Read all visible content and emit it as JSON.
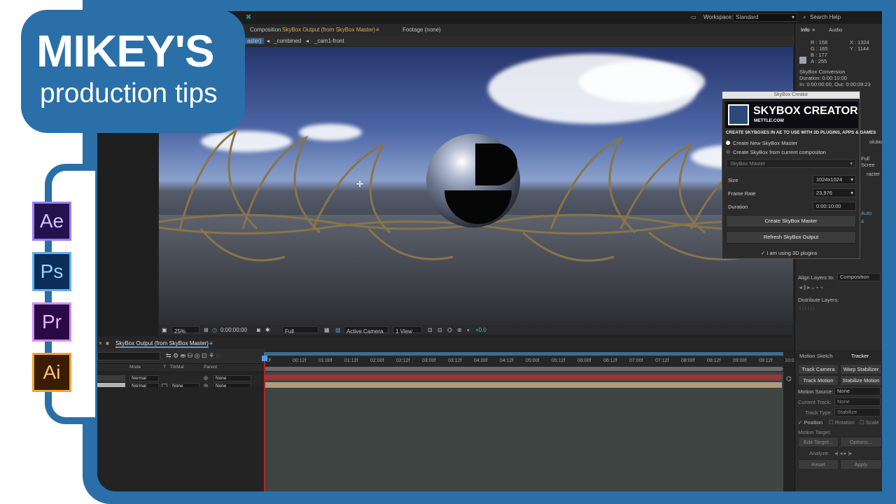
{
  "brand": {
    "title": "MIKEY'S",
    "subtitle": "production tips"
  },
  "apps": [
    "Ae",
    "Ps",
    "Pr",
    "Ai"
  ],
  "topbar": {
    "workspace_label": "Workspace:",
    "workspace_value": "Standard",
    "search_placeholder": "Search Help"
  },
  "composition": {
    "tab_label": "Composition",
    "tab_name": "SkyBox Output (from SkyBox Master)",
    "footage_tab": "Footage (none)",
    "subnav": [
      "aster)",
      "_combined",
      "_cam1-front"
    ]
  },
  "viewer_bar": {
    "zoom": "25%",
    "timecode": "0:00:00:00",
    "resolution": "Full",
    "camera": "Active Camera",
    "views": "1 View",
    "exposure": "+0.0"
  },
  "info_panel": {
    "tabs": [
      "Info",
      "Audio"
    ],
    "r": "R : 158",
    "g": "G : 165",
    "b": "B : 177",
    "a": "A : 255",
    "x": "X : 1324",
    "y": "Y : 1144",
    "comp_name": "SkyBox Conversion",
    "duration": "Duration: 0:00:10:00",
    "inout": "In: 0:00:00:00, Out: 0:00:09:23"
  },
  "right_misc": {
    "frag1": "olution",
    "frag2": "Full Scree",
    "frag3": "racter",
    "frag4": "Auto",
    "frag5": "4"
  },
  "align": {
    "label": "Align Layers to:",
    "value": "Composition",
    "distribute": "Distribute Layers:"
  },
  "tracker": {
    "tabs": [
      "Motion Sketch",
      "Tracker"
    ],
    "track_camera": "Track Camera",
    "warp_stabilizer": "Warp Stabilizer",
    "track_motion": "Track Motion",
    "stabilize_motion": "Stabilize Motion",
    "motion_source_label": "Motion Source:",
    "motion_source_value": "None",
    "current_track_label": "Current Track:",
    "current_track_value": "None",
    "track_type_label": "Track Type:",
    "track_type_value": "Stabilize",
    "position": "Position",
    "rotation": "Rotation",
    "scale": "Scale",
    "motion_target": "Motion Target:",
    "edit_target": "Edit Target...",
    "options": "Options...",
    "analyze": "Analyze:",
    "reset": "Reset",
    "apply": "Apply"
  },
  "timeline": {
    "tab": "SkyBox Output (from SkyBox Master)",
    "columns": [
      "Mode",
      "T",
      "TrkMat",
      "Parent"
    ],
    "layers": [
      {
        "mode": "Normal",
        "trkmat": "",
        "parent": "None"
      },
      {
        "mode": "Normal",
        "trkmat": "None",
        "parent": "None"
      }
    ],
    "ruler": [
      "0f",
      "00:12f",
      "01:00f",
      "01:12f",
      "02:00f",
      "02:12f",
      "03:00f",
      "03:12f",
      "04:00f",
      "04:12f",
      "05:00f",
      "05:12f",
      "06:00f",
      "06:12f",
      "07:00f",
      "07:12f",
      "08:00f",
      "08:12f",
      "09:00f",
      "09:12f",
      "10:0"
    ]
  },
  "skybox": {
    "window_title": "SkyBox Creator",
    "logo_name": "SKYBOX CREATOR",
    "logo_site": "METTLE.COM",
    "tagline": "CREATE SKYBOXES IN AE TO USE WITH 3D PLUGINS, APPS & GAMES",
    "option_new": "Create New SkyBox Master",
    "option_current": "Create SkyBox from current compositon",
    "master_select": "SkyBox Master",
    "size_label": "Size",
    "size_value": "1024x1024",
    "framerate_label": "Frame Rate",
    "framerate_value": "23,976",
    "duration_label": "Duration",
    "duration_value": "0:00:10:00",
    "create_button": "Create SkyBox Master",
    "refresh_button": "Refresh SkyBox Output",
    "plugins_check": "I am using 3D plugins"
  }
}
